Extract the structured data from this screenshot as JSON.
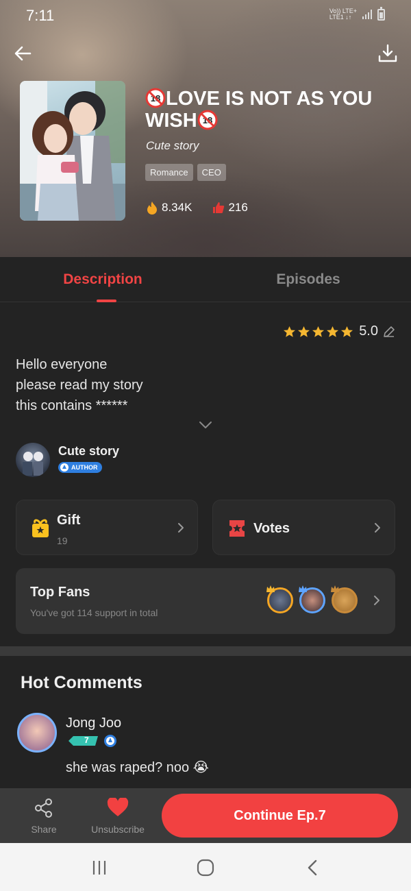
{
  "status_bar": {
    "time": "7:11",
    "network_top": "Vo)) LTE+",
    "network_bottom": "LTE1 ↓↑"
  },
  "book": {
    "title": "LOVE IS NOT AS YOU WISH",
    "age_rating": "18",
    "author_line": "Cute story",
    "tags": [
      "Romance",
      "CEO"
    ],
    "views": "8.34K",
    "likes": "216"
  },
  "tabs": [
    {
      "label": "Description",
      "active": true
    },
    {
      "label": "Episodes",
      "active": false
    }
  ],
  "rating": {
    "stars": 5,
    "value": "5.0"
  },
  "description": [
    "Hello everyone",
    "please read my story",
    "this contains ******"
  ],
  "author": {
    "name": "Cute story",
    "badge": "AUTHOR"
  },
  "gift": {
    "label": "Gift",
    "count": "19"
  },
  "votes": {
    "label": "Votes"
  },
  "top_fans": {
    "title": "Top Fans",
    "subtitle": "You've got 114 support in total"
  },
  "hot_comments": {
    "title": "Hot Comments",
    "comments": [
      {
        "user": "Jong Joo",
        "level": "7",
        "text": "she was raped? noo 😭"
      }
    ]
  },
  "actions": {
    "share_label": "Share",
    "unsubscribe_label": "Unsubscribe",
    "continue_label": "Continue Ep.7"
  },
  "colors": {
    "accent": "#f04444",
    "button": "#f24141",
    "star": "#f5b731",
    "gift": "#f9c11f",
    "votes": "#e84545"
  }
}
